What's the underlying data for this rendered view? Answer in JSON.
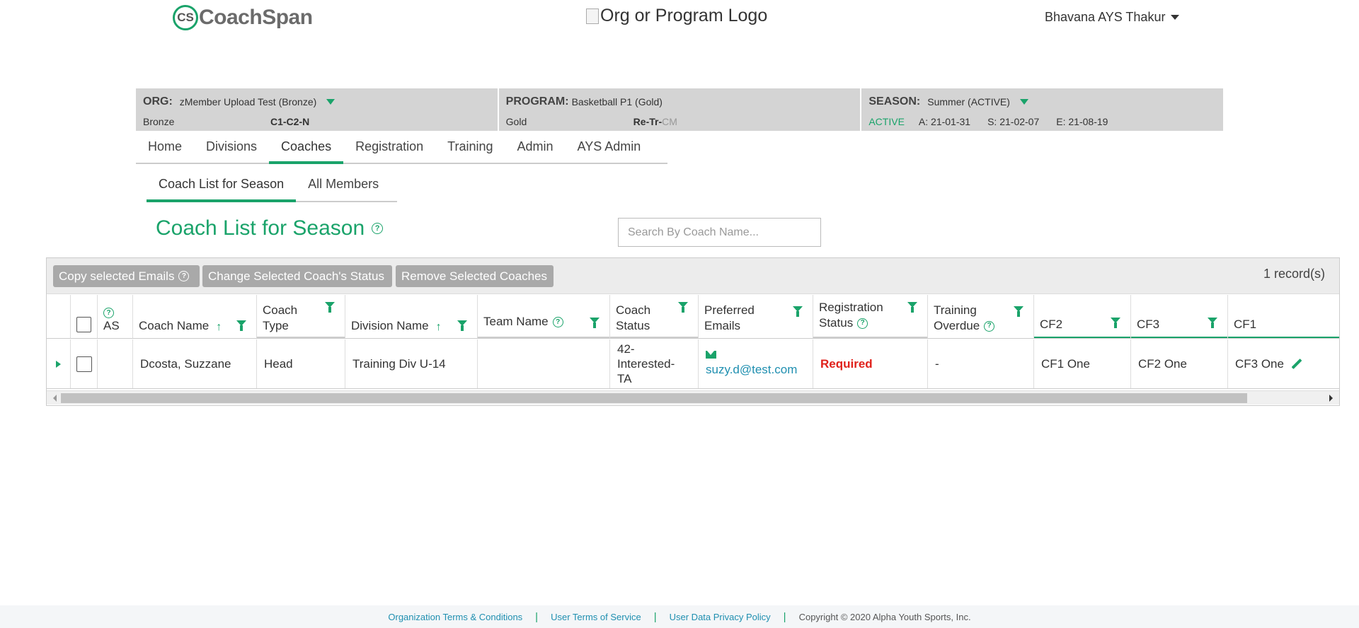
{
  "header": {
    "logo_mark": "CS",
    "logo_text_1": "Coach",
    "logo_text_2": "Span",
    "org_logo_alt": "Org or Program Logo",
    "user_name": "Bhavana AYS Thakur"
  },
  "context": {
    "org_label": "ORG:",
    "org_value": "zMember Upload Test (Bronze)",
    "org_tier": "Bronze",
    "org_code": "C1-C2-N",
    "program_label": "PROGRAM:",
    "program_value": "Basketball P1 (Gold)",
    "program_tier": "Gold",
    "program_code_main": "Re-Tr-",
    "program_code_muted": "CM",
    "season_label": "SEASON:",
    "season_value": "Summer (ACTIVE)",
    "season_status": "ACTIVE",
    "season_a": "A: 21-01-31",
    "season_s": "S: 21-02-07",
    "season_e": "E: 21-08-19"
  },
  "nav": {
    "items": [
      "Home",
      "Divisions",
      "Coaches",
      "Registration",
      "Training",
      "Admin",
      "AYS Admin"
    ],
    "active": "Coaches"
  },
  "subtabs": {
    "items": [
      "Coach List for Season",
      "All Members"
    ],
    "active": "Coach List for Season"
  },
  "page": {
    "title": "Coach List for Season",
    "help": "?",
    "search_placeholder": "Search By Coach Name..."
  },
  "toolbar": {
    "copy_emails": "Copy selected Emails",
    "change_status": "Change Selected Coach's Status",
    "remove": "Remove Selected Coaches",
    "record_count": "1 record(s)"
  },
  "table": {
    "headers": {
      "as": "AS",
      "coach_name": "Coach Name",
      "coach_type_1": "Coach",
      "coach_type_2": "Type",
      "division_name": "Division Name",
      "team_name": "Team Name",
      "coach_status_1": "Coach",
      "coach_status_2": "Status",
      "pref_emails_1": "Preferred",
      "pref_emails_2": "Emails",
      "reg_status_1": "Registration",
      "reg_status_2": "Status",
      "training_1": "Training",
      "training_2": "Overdue",
      "cf2": "CF2",
      "cf3": "CF3",
      "cf1": "CF1"
    },
    "sort_arrow": "↑",
    "rows": [
      {
        "coach_name": "Dcosta, Suzzane",
        "coach_type": "Head",
        "division": "Training Div U-14",
        "team": "",
        "coach_status_1": "42-",
        "coach_status_2": "Interested-",
        "coach_status_3": "TA",
        "email": "suzy.d@test.com",
        "registration": "Required",
        "training": "-",
        "cf2": "CF1 One",
        "cf3": "CF2 One",
        "cf1": "CF3 One"
      }
    ]
  },
  "footer": {
    "org_terms": "Organization Terms & Conditions",
    "user_terms": "User Terms of Service",
    "privacy": "User Data Privacy Policy",
    "copyright": "Copyright © 2020 Alpha Youth Sports, Inc.",
    "sep": "|"
  },
  "colors": {
    "accent": "#1aa36a",
    "link": "#1f8fb0",
    "required": "#e0211b",
    "context_bg": "#d4d4d4"
  }
}
